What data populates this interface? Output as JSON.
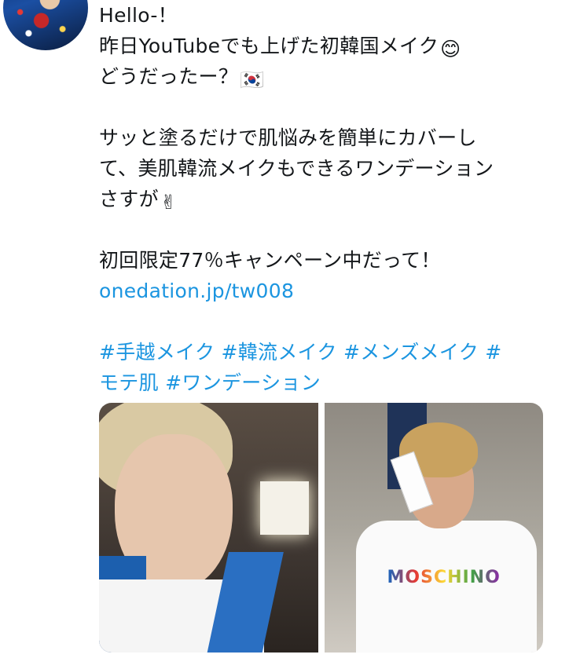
{
  "tweet": {
    "lines": [
      "Hello-！",
      "昨日YouTubeでも上げた初韓国メイク",
      "どうだったー？",
      "",
      "サッと塗るだけで肌悩みを簡単にカバーし",
      "て、美肌韓流メイクもできるワンデーション",
      "さすが",
      "",
      "初回限定77％キャンペーン中だって！"
    ],
    "link": "onedation.jp/tw008",
    "hashtags_line1": "#手越メイク #韓流メイク #メンズメイク #",
    "hashtags_line2": "モテ肌 #ワンデーション",
    "emojis": {
      "smile": "😊",
      "flag": "🇰🇷",
      "victory": "✌"
    }
  },
  "media": {
    "photo2_logo": "MOSCHINO"
  },
  "colors": {
    "link": "#1b95e0",
    "text": "#14171a"
  }
}
